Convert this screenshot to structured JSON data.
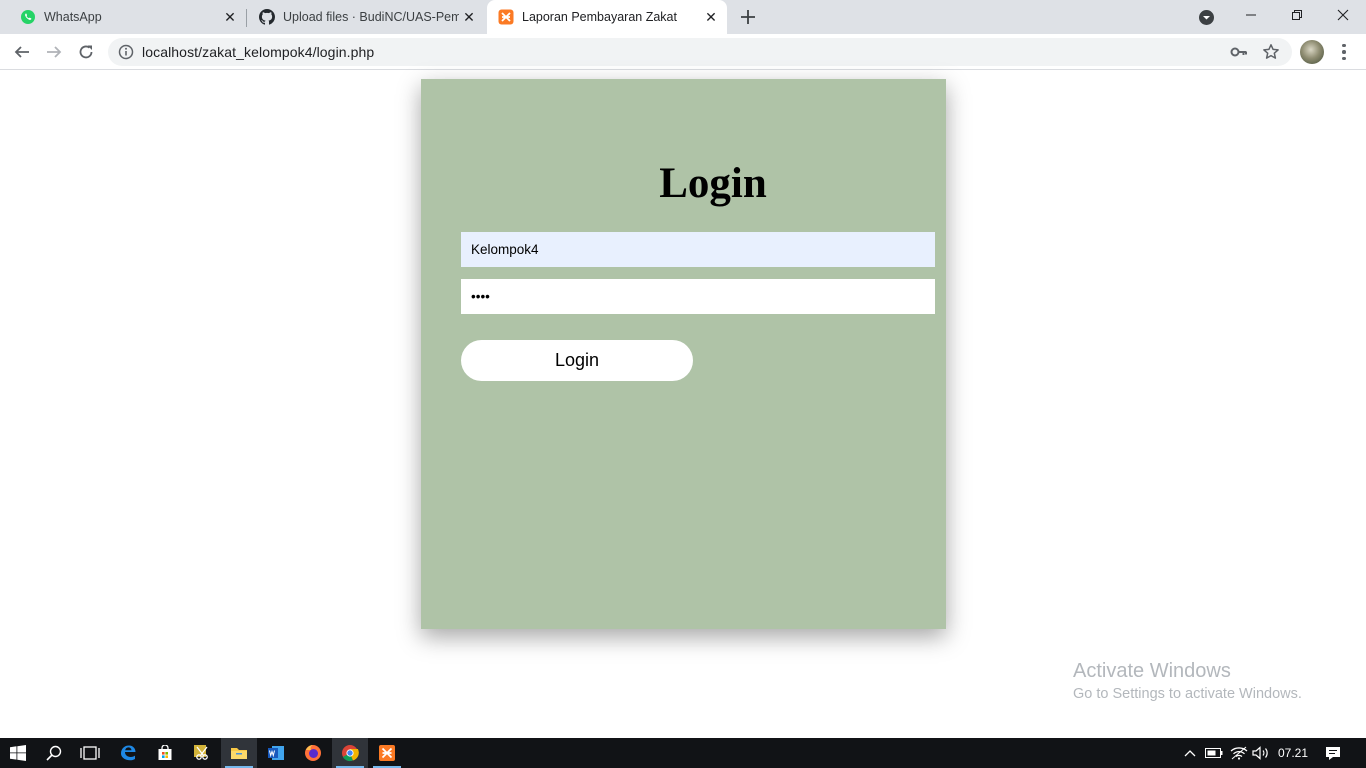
{
  "browser": {
    "tabs": [
      {
        "title": "WhatsApp",
        "icon": "whatsapp-icon",
        "active": false
      },
      {
        "title": "Upload files · BudiNC/UAS-Pemrograman",
        "icon": "github-icon",
        "active": false
      },
      {
        "title": "Laporan Pembayaran Zakat",
        "icon": "xampp-icon",
        "active": true
      }
    ],
    "address_bar": {
      "url": "localhost/zakat_kelompok4/login.php"
    }
  },
  "login": {
    "title": "Login",
    "username_value": "Kelompok4",
    "password_value": "••••",
    "button_label": "Login"
  },
  "watermark": {
    "line1": "Activate Windows",
    "line2": "Go to Settings to activate Windows."
  },
  "taskbar": {
    "pinned": [
      "start-icon",
      "search-icon",
      "task-view-icon",
      "edge-icon",
      "store-icon",
      "snipping-tool-icon",
      "file-explorer-icon",
      "word-icon",
      "firefox-icon",
      "chrome-icon",
      "xampp-icon"
    ],
    "active_app": "chrome-icon",
    "clock": "07.21"
  },
  "colors": {
    "card_background": "#afc3a7",
    "autofill_background": "#e8f0fe",
    "tabstrip": "#dee1e6",
    "taskbar": "#111316"
  }
}
